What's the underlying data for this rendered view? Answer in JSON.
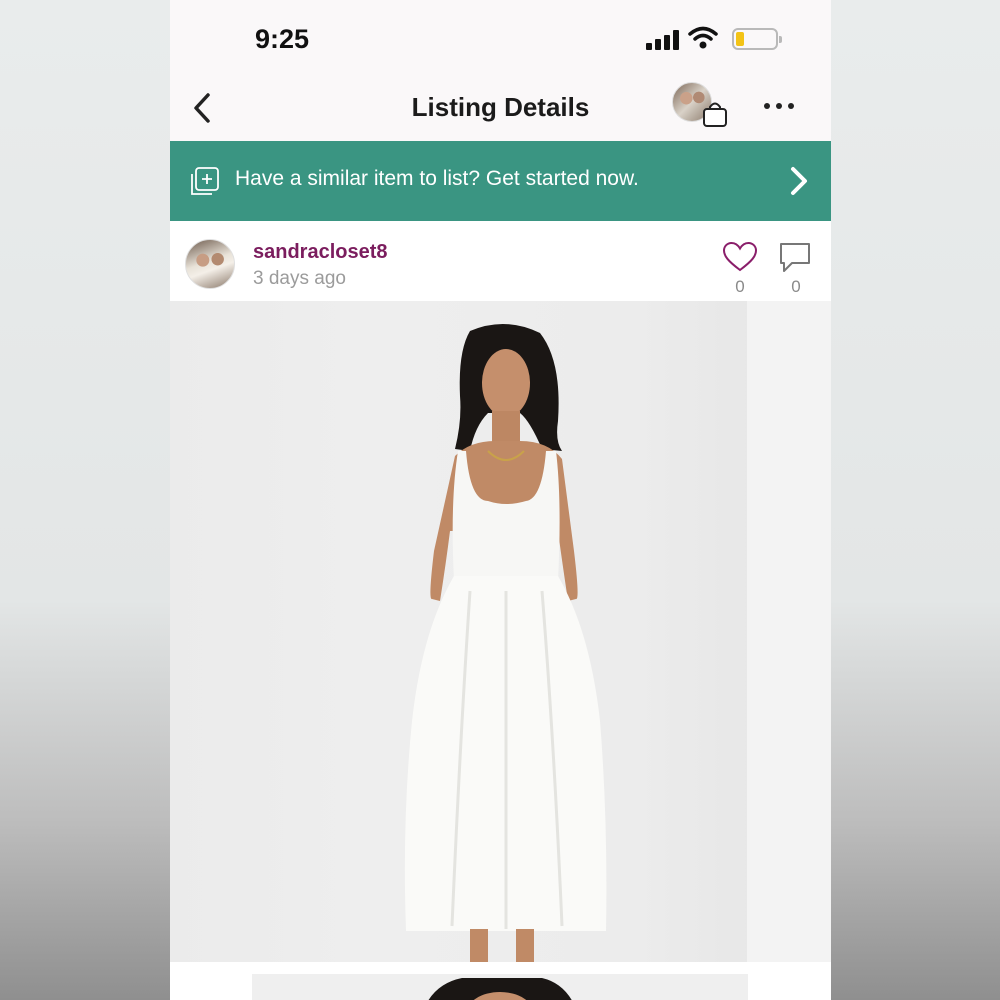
{
  "status_bar": {
    "time": "9:25"
  },
  "nav": {
    "title": "Listing Details"
  },
  "promo": {
    "text": "Have a similar item to list? Get started now."
  },
  "seller": {
    "username": "sandracloset8",
    "posted": "3 days ago",
    "likes": "0",
    "comments": "0"
  },
  "colors": {
    "promo_bg": "#3a9582",
    "username": "#7b1d5e",
    "like_icon": "#8a1e6a",
    "battery": "#f3c316"
  },
  "icons": {
    "back": "chevron-left-icon",
    "bag": "shopping-bag-icon",
    "more": "ellipsis-icon",
    "promo": "add-listing-icon",
    "promo_arrow": "chevron-right-icon",
    "like": "heart-icon",
    "comment": "comment-icon"
  }
}
